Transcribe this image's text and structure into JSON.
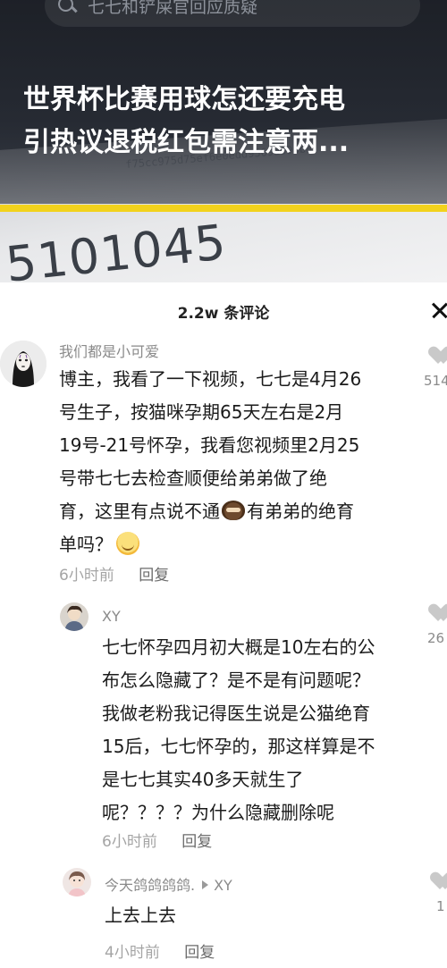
{
  "video": {
    "search_text": "七七和铲屎官回应质疑",
    "headline_line1": "世界杯比赛用球怎还要充电",
    "headline_line2": "引热议退税红包需注意两...",
    "bg_hash": "f75cc975d75ef6e0edd9569a990b0",
    "bg_number": "5101045"
  },
  "comments_panel": {
    "title": "2.2w 条评论",
    "comments": [
      {
        "username": "我们都是小可爱",
        "lines": [
          "博主，我看了一下视频，七七是4月26",
          "号生子，按猫咪孕期65天左右是2月",
          "19号-21号怀孕，我看您视频里2月25",
          "号带七七去检查顺便给弟弟做了绝",
          "育，这里有点说不通",
          "有弟弟的绝育",
          "单吗？"
        ],
        "time": "6小时前",
        "reply_label": "回复",
        "like_count": "514"
      },
      {
        "username": "XY",
        "lines": [
          "七七怀孕四月初大概是10左右的公",
          "布怎么隐藏了？是不是有问题呢？",
          "我做老粉我记得医生说是公猫绝育",
          "15后，七七怀孕的，那这样算是不",
          "是七七其实40多天就生了",
          "呢？？？？为什么隐藏删除呢"
        ],
        "time": "6小时前",
        "reply_label": "回复",
        "like_count": "26"
      },
      {
        "username": "今天鸽鸽鸽鸽.",
        "reply_to": "XY",
        "lines": [
          "上去上去"
        ],
        "time": "4小时前",
        "reply_label": "回复",
        "like_count": "1"
      }
    ]
  },
  "icons": {
    "search": "search-icon",
    "close": "close-icon",
    "like": "heart-icon"
  }
}
